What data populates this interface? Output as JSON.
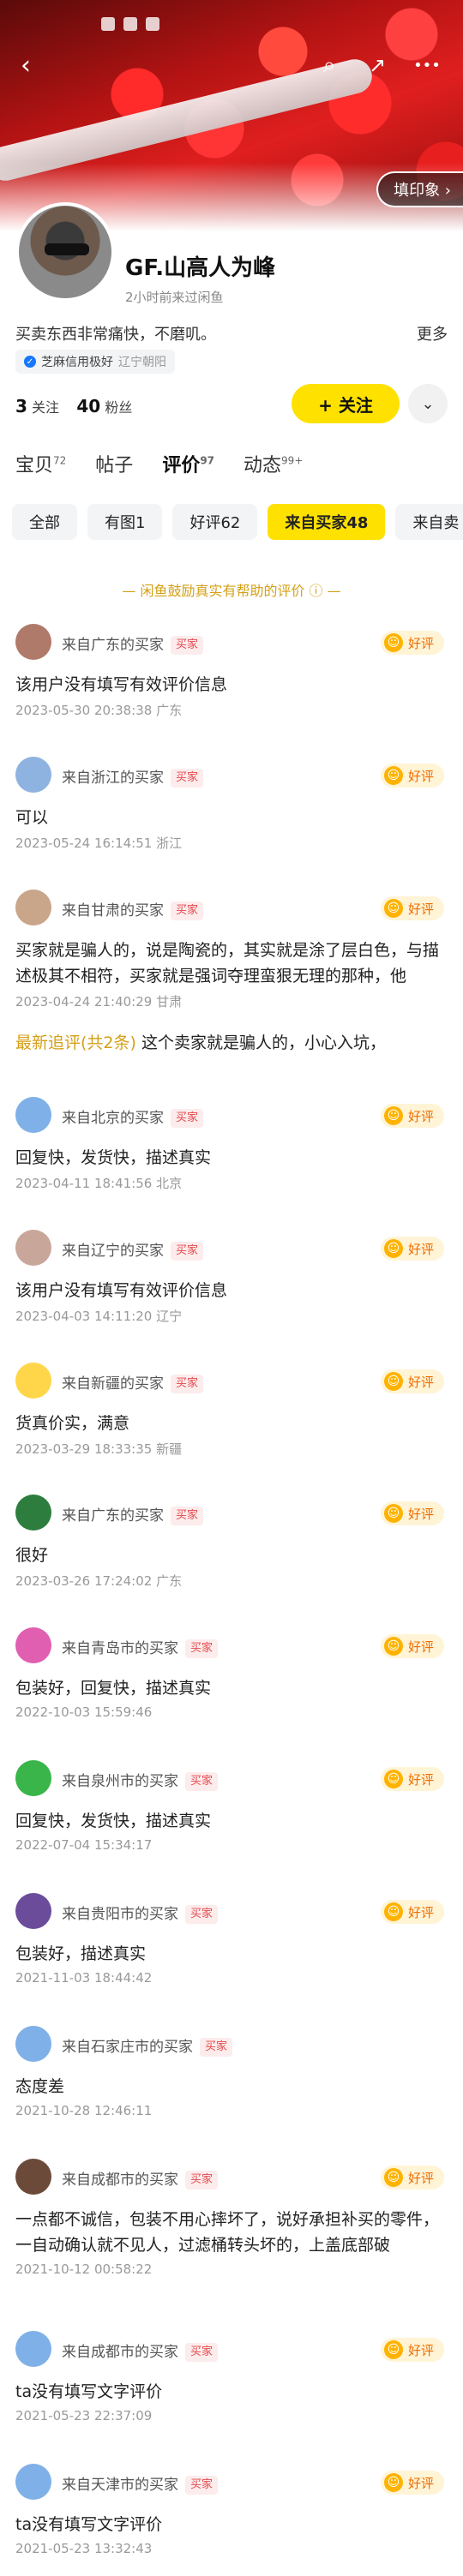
{
  "header": {
    "back_icon": "‹",
    "search_icon": "⌕",
    "share_icon": "↗",
    "more_icon": "•••",
    "impression_label": "填印象 ›"
  },
  "profile": {
    "nickname": "GF.山高人为峰",
    "last_seen": "2小时前来过闲鱼",
    "bio": "买卖东西非常痛快，不磨叽。",
    "bio_more": "更多",
    "credit": "芝麻信用极好",
    "location": "辽宁朝阳",
    "follow_count": "3",
    "follow_label": "关注",
    "fans_count": "40",
    "fans_label": "粉丝",
    "follow_button": "+ 关注",
    "more_button": "⌄"
  },
  "tabs": [
    {
      "label": "宝贝",
      "count": "72"
    },
    {
      "label": "帖子",
      "count": ""
    },
    {
      "label": "评价",
      "count": "97"
    },
    {
      "label": "动态",
      "count": "99+"
    }
  ],
  "filters": [
    "全部",
    "有图1",
    "好评62",
    "来自买家48",
    "来自卖"
  ],
  "notice": "— 闲鱼鼓励真实有帮助的评价 ⓘ —",
  "good_label": "好评",
  "buyer_tag": "买家",
  "reviews": [
    {
      "from": "来自广东的买家",
      "text": "该用户没有填写有效评价信息",
      "meta": "2023-05-30 20:38:38  广东"
    },
    {
      "from": "来自浙江的买家",
      "text": "可以",
      "meta": "2023-05-24 16:14:51  浙江"
    },
    {
      "from": "来自甘肃的买家",
      "text": "买家就是骗人的，说是陶瓷的，其实就是涂了层白色，与描述极其不相符，买家就是强词夺理蛮狠无理的那种，他",
      "meta": "2023-04-24 21:40:29  甘肃",
      "followup_label": "最新追评(共2条)",
      "followup_text": " 这个卖家就是骗人的，小心入坑，"
    },
    {
      "from": "来自北京的买家",
      "text": "回复快，发货快，描述真实",
      "meta": "2023-04-11 18:41:56  北京"
    },
    {
      "from": "来自辽宁的买家",
      "text": "该用户没有填写有效评价信息",
      "meta": "2023-04-03 14:11:20  辽宁"
    },
    {
      "from": "来自新疆的买家",
      "text": "货真价实，满意",
      "meta": "2023-03-29 18:33:35  新疆"
    },
    {
      "from": "来自广东的买家",
      "text": "很好",
      "meta": "2023-03-26 17:24:02  广东"
    },
    {
      "from": "来自青岛市的买家",
      "text": "包装好，回复快，描述真实",
      "meta": "2022-10-03 15:59:46"
    },
    {
      "from": "来自泉州市的买家",
      "text": "回复快，发货快，描述真实",
      "meta": "2022-07-04 15:34:17"
    },
    {
      "from": "来自贵阳市的买家",
      "text": "包装好，描述真实",
      "meta": "2021-11-03 18:44:42"
    },
    {
      "from": "来自石家庄市的买家",
      "text": "态度差",
      "meta": "2021-10-28 12:46:11"
    },
    {
      "from": "来自成都市的买家",
      "text": "一点都不诚信，包装不用心摔坏了，说好承担补买的零件，一自动确认就不见人，过滤桶转头坏的，上盖底部破",
      "meta": "2021-10-12 00:58:22"
    },
    {
      "from": "来自成都市的买家",
      "text": "ta没有填写文字评价",
      "meta": "2021-05-23 22:37:09"
    },
    {
      "from": "来自天津市的买家",
      "text": "ta没有填写文字评价",
      "meta": "2021-05-23 13:32:43"
    }
  ],
  "colors": {
    "accent": "#ffe100",
    "tag": "#e5484d",
    "good": "#ef6c00",
    "notice": "#d4a017"
  }
}
